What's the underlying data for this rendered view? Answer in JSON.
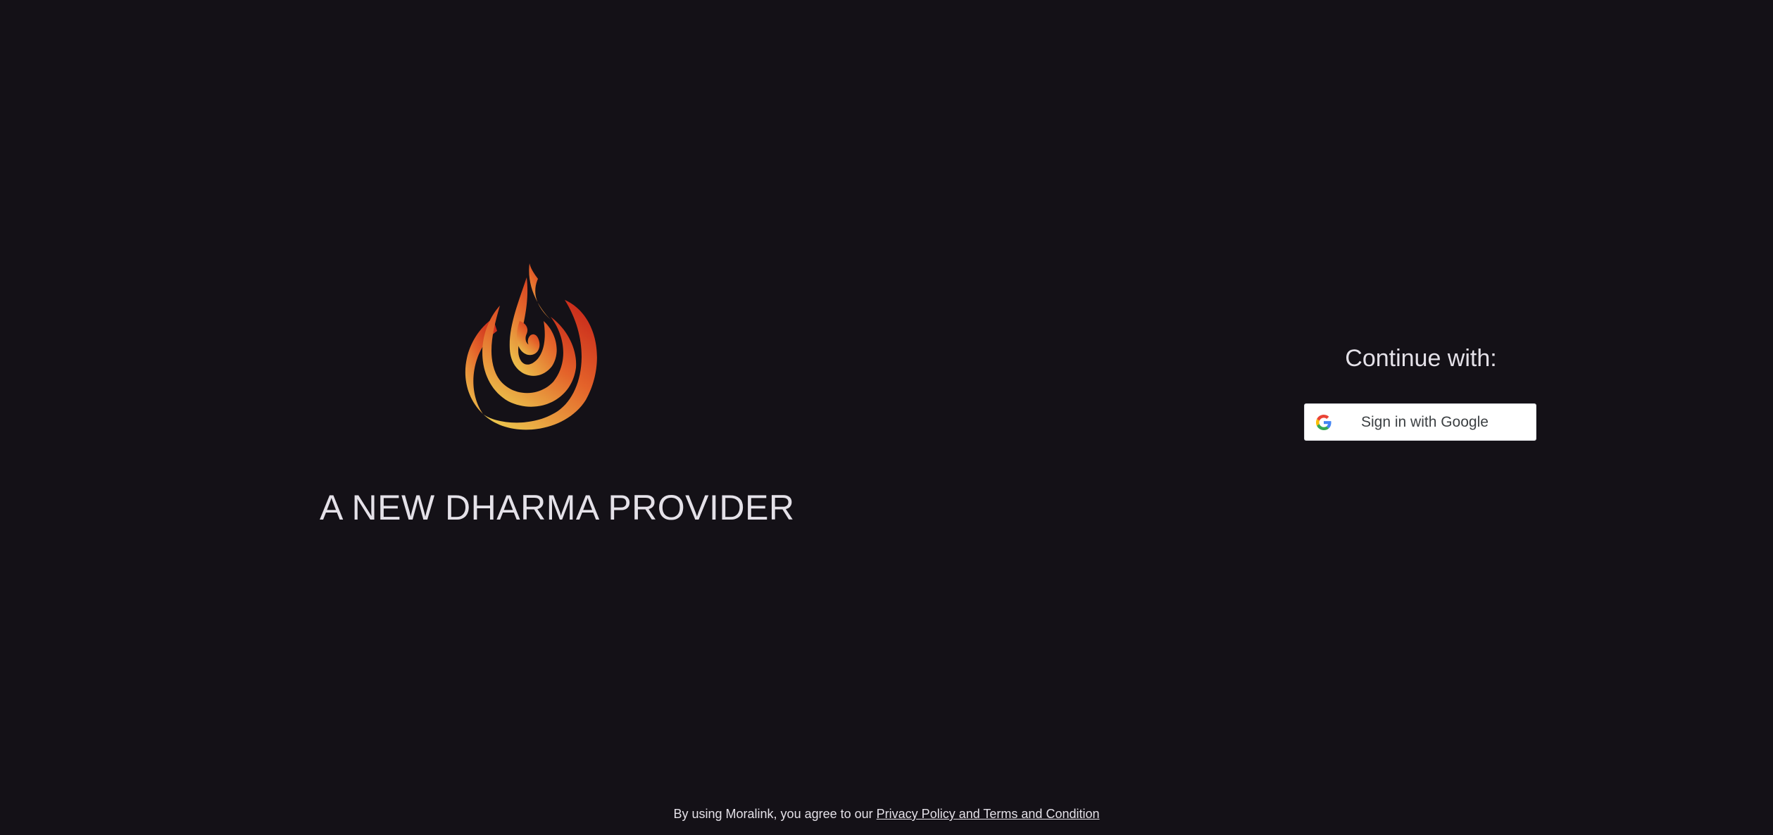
{
  "brand": {
    "logo_icon": "flame-spiral-logo",
    "tagline": "A NEW DHARMA PROVIDER",
    "logo_colors": [
      "#d2331e",
      "#e8762a",
      "#e9c049"
    ]
  },
  "auth": {
    "heading": "Continue with:",
    "google_button_label": "Sign in with Google",
    "google_icon": "google-icon"
  },
  "footer": {
    "prefix": "By using Moralink, you agree to our",
    "link_label": "Privacy Policy and Terms and Condition"
  },
  "colors": {
    "background": "#141117",
    "text": "#e4e1e8",
    "button_bg": "#ffffff",
    "button_text": "#3c4043"
  }
}
